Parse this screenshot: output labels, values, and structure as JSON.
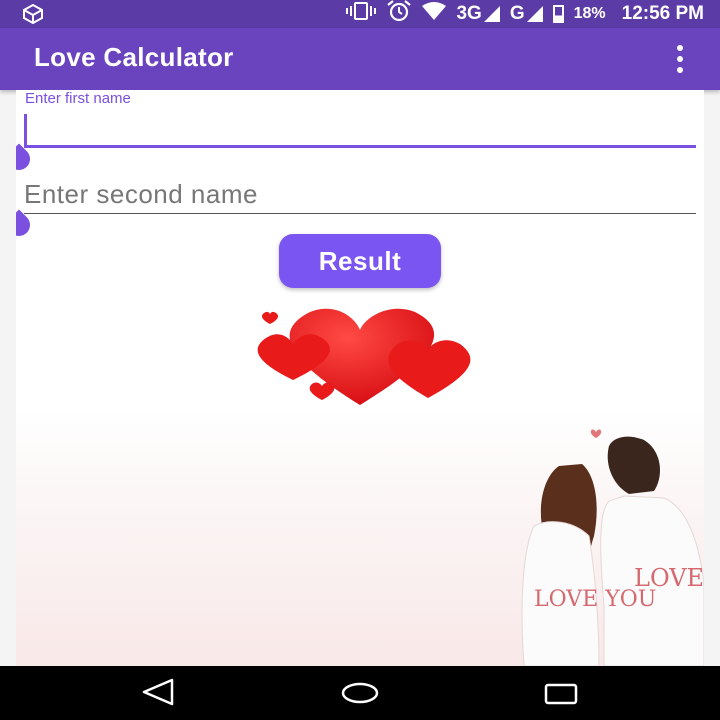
{
  "status_bar": {
    "network_3g": "3G",
    "network_g": "G",
    "battery_percent": "18%",
    "time": "12:56 PM",
    "icons": [
      "app-notification-icon",
      "vibrate-icon",
      "alarm-icon",
      "wifi-icon",
      "signal-icon",
      "battery-icon"
    ]
  },
  "app_bar": {
    "title": "Love Calculator",
    "menu_icon": "more-vert-icon"
  },
  "form": {
    "first_name_label": "Enter first name",
    "first_name_value": "",
    "second_name_placeholder": "Enter second name",
    "second_name_value": "",
    "result_label": "Result"
  },
  "illustration": {
    "hearts": "hearts-image",
    "couple": "couple-image",
    "shirt_text_left": "LOVE YOU",
    "shirt_text_right": "LOVE YOU"
  },
  "nav_bar": {
    "icons": [
      "back-icon",
      "home-icon",
      "recent-apps-icon"
    ]
  },
  "colors": {
    "status_bar": "#5b3ba6",
    "app_bar": "#6a43be",
    "accent": "#7b4fe0",
    "button": "#7b55f1",
    "heart": "#e8181c"
  }
}
